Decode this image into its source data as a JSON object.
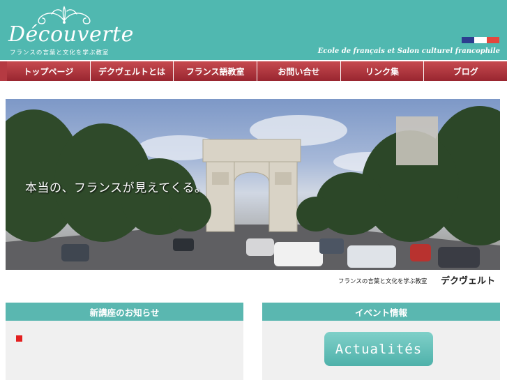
{
  "header": {
    "logo": "Découverte",
    "logo_subtitle": "フランスの言葉と文化を学ぶ教室",
    "tagline": "Ecole de français et Salon culturel francophile",
    "flag_colors": [
      "#2c3d8f",
      "#ffffff",
      "#e4473d"
    ]
  },
  "nav": {
    "items": [
      {
        "label": "トップページ"
      },
      {
        "label": "デクヴェルトとは"
      },
      {
        "label": "フランス語教室"
      },
      {
        "label": "お問い合せ"
      },
      {
        "label": "リンク集"
      },
      {
        "label": "ブログ"
      }
    ]
  },
  "hero": {
    "caption": "本当の、フランスが見えてくる。"
  },
  "subtitle": {
    "small": "フランスの言葉と文化を学ぶ教室",
    "big": "デクヴェルト"
  },
  "left_box": {
    "title": "新講座のお知らせ"
  },
  "right_box": {
    "title": "イベント情報",
    "button": "Actualités"
  },
  "colors": {
    "teal": "#50b8b0",
    "nav_red": "#a92f38",
    "bullet_red": "#e31f1f"
  }
}
